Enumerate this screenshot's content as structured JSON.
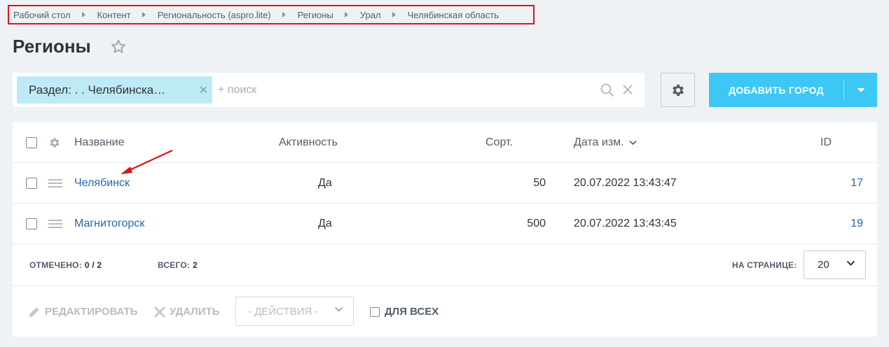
{
  "breadcrumb": [
    "Рабочий стол",
    "Контент",
    "Региональность (aspro.lite)",
    "Регионы",
    "Урал",
    "Челябинская область"
  ],
  "page_title": "Регионы",
  "filter": {
    "chip_label": "Раздел: . . Челябинска…",
    "search_placeholder": "+ поиск"
  },
  "add_button_label": "ДОБАВИТЬ ГОРОД",
  "table": {
    "columns": {
      "name": "Название",
      "active": "Активность",
      "sort": "Сорт.",
      "date": "Дата изм.",
      "id": "ID"
    },
    "rows": [
      {
        "name": "Челябинск",
        "active": "Да",
        "sort": "50",
        "date": "20.07.2022 13:43:47",
        "id": "17"
      },
      {
        "name": "Магнитогорск",
        "active": "Да",
        "sort": "500",
        "date": "20.07.2022 13:43:45",
        "id": "19"
      }
    ]
  },
  "footer": {
    "selected_label": "ОТМЕЧЕНО:",
    "selected_value": "0 / 2",
    "total_label": "ВСЕГО:",
    "total_value": "2",
    "per_page_label": "НА СТРАНИЦЕ:",
    "per_page_value": "20"
  },
  "actions": {
    "edit": "РЕДАКТИРОВАТЬ",
    "delete": "УДАЛИТЬ",
    "select_placeholder": "- ДЕЙСТВИЯ -",
    "for_all": "ДЛЯ ВСЕХ"
  },
  "colors": {
    "accent": "#3bc8f5",
    "link": "#2067b0",
    "highlight_box": "#e0121b",
    "chip_bg": "#bdebf5",
    "background": "#eef2f4"
  }
}
